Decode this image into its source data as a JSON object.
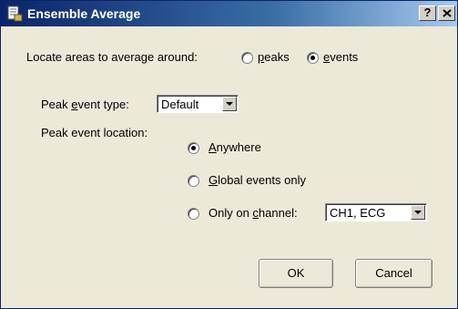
{
  "window": {
    "title": "Ensemble Average",
    "help_label": "?"
  },
  "locate": {
    "label": "Locate areas to average around:",
    "options": [
      {
        "accel": "p",
        "rest": "eaks",
        "selected": false
      },
      {
        "accel": "e",
        "rest": "vents",
        "selected": true
      }
    ]
  },
  "peak_type": {
    "label_pre": "Peak ",
    "label_accel": "e",
    "label_post": "vent type:",
    "value": "Default"
  },
  "peak_location": {
    "label": "Peak event location:",
    "options": [
      {
        "accel": "A",
        "rest": "nywhere",
        "selected": true
      },
      {
        "accel": "G",
        "rest": "lobal events only",
        "selected": false
      },
      {
        "pre": "Only on ",
        "accel": "c",
        "rest": "hannel:",
        "selected": false
      }
    ],
    "channel_value": "CH1, ECG"
  },
  "buttons": {
    "ok": "OK",
    "cancel": "Cancel"
  }
}
